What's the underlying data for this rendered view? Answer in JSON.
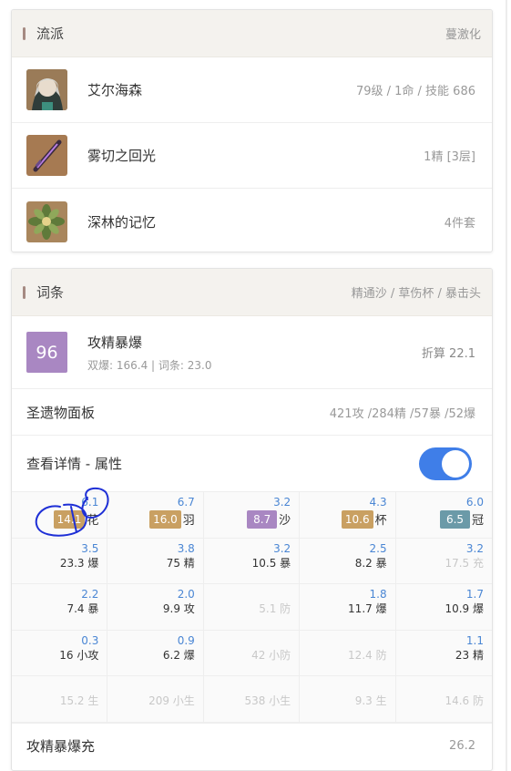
{
  "build": {
    "header": {
      "title": "流派",
      "subtitle": "蔓激化"
    },
    "character": {
      "name": "艾尔海森",
      "meta": "79级 / 1命 / 技能 686"
    },
    "weapon": {
      "name": "雾切之回光",
      "meta": "1精 [3层]"
    },
    "artifact_set": {
      "name": "深林的记忆",
      "meta": "4件套"
    }
  },
  "substats": {
    "header": {
      "title": "词条",
      "subtitle": "精通沙 / 草伤杯 / 暴击头"
    },
    "score": {
      "value": "96",
      "label": "攻精暴爆",
      "detail": "双爆: 166.4 | 词条: 23.0",
      "meta": "折算 22.1"
    },
    "panel": {
      "label": "圣遗物面板",
      "meta": "421攻 /284精 /57暴 /52爆"
    },
    "detail_toggle": {
      "label": "查看详情 - 属性",
      "on": true
    },
    "colors": {
      "gold": "#c9a062",
      "purple": "#a987c2",
      "teal": "#6b9aa8",
      "toggle": "#3f7ee8",
      "annotation": "#1e2fd6"
    },
    "main_row": [
      {
        "up": "6.1",
        "badge": "14.1",
        "badge_color": "gold",
        "slot": "花"
      },
      {
        "up": "6.7",
        "badge": "16.0",
        "badge_color": "gold",
        "slot": "羽"
      },
      {
        "up": "3.2",
        "badge": "8.7",
        "badge_color": "purple",
        "slot": "沙"
      },
      {
        "up": "4.3",
        "badge": "10.6",
        "badge_color": "gold",
        "slot": "杯"
      },
      {
        "up": "6.0",
        "badge": "6.5",
        "badge_color": "teal",
        "slot": "冠"
      }
    ],
    "rows": [
      [
        {
          "up": "3.5",
          "val": "23.3 爆",
          "faded": false
        },
        {
          "up": "3.8",
          "val": "75 精",
          "faded": false
        },
        {
          "up": "3.2",
          "val": "10.5 暴",
          "faded": false
        },
        {
          "up": "2.5",
          "val": "8.2 暴",
          "faded": false
        },
        {
          "up": "3.2",
          "val": "17.5 充",
          "faded": true
        }
      ],
      [
        {
          "up": "2.2",
          "val": "7.4 暴",
          "faded": false
        },
        {
          "up": "2.0",
          "val": "9.9 攻",
          "faded": false
        },
        {
          "up": "",
          "val": "5.1 防",
          "faded": true
        },
        {
          "up": "1.8",
          "val": "11.7 爆",
          "faded": false
        },
        {
          "up": "1.7",
          "val": "10.9 爆",
          "faded": false
        }
      ],
      [
        {
          "up": "0.3",
          "val": "16 小攻",
          "faded": false
        },
        {
          "up": "0.9",
          "val": "6.2 爆",
          "faded": false
        },
        {
          "up": "",
          "val": "42 小防",
          "faded": true
        },
        {
          "up": "",
          "val": "12.4 防",
          "faded": true
        },
        {
          "up": "1.1",
          "val": "23 精",
          "faded": false
        }
      ],
      [
        {
          "up": "",
          "val": "15.2 生",
          "faded": true
        },
        {
          "up": "",
          "val": "209 小生",
          "faded": true
        },
        {
          "up": "",
          "val": "538 小生",
          "faded": true
        },
        {
          "up": "",
          "val": "9.3 生",
          "faded": true
        },
        {
          "up": "",
          "val": "14.6 防",
          "faded": true
        }
      ]
    ],
    "footer": {
      "label": "攻精暴爆充",
      "meta": "26.2"
    }
  }
}
